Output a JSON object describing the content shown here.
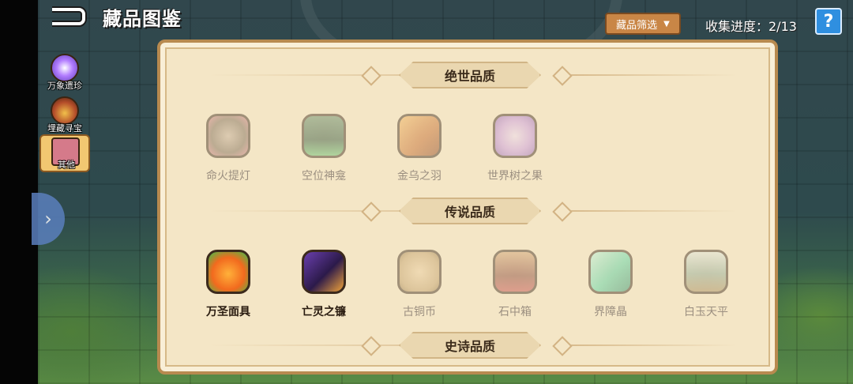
{
  "header": {
    "title": "藏品图鉴",
    "filter_label": "藏品筛选",
    "progress": "收集进度：2/13",
    "help_label": "?"
  },
  "sidebar": {
    "items": [
      {
        "label": "万象遗珍",
        "active": false
      },
      {
        "label": "埋藏寻宝",
        "active": false
      },
      {
        "label": "其他",
        "active": true
      }
    ]
  },
  "sections": [
    {
      "title": "绝世品质",
      "items": [
        {
          "name": "命火提灯",
          "owned": false,
          "icon": "lantern-icon"
        },
        {
          "name": "空位神龛",
          "owned": false,
          "icon": "shrine-icon"
        },
        {
          "name": "金乌之羽",
          "owned": false,
          "icon": "feather-icon"
        },
        {
          "name": "世界树之果",
          "owned": false,
          "icon": "fruit-icon"
        }
      ]
    },
    {
      "title": "传说品质",
      "items": [
        {
          "name": "万圣面具",
          "owned": true,
          "icon": "pumpkin-mask-icon"
        },
        {
          "name": "亡灵之镰",
          "owned": true,
          "icon": "scythe-icon"
        },
        {
          "name": "古铜币",
          "owned": false,
          "icon": "coin-icon"
        },
        {
          "name": "石中箱",
          "owned": false,
          "icon": "chest-icon"
        },
        {
          "name": "界障晶",
          "owned": false,
          "icon": "crystal-icon"
        },
        {
          "name": "白玉天平",
          "owned": false,
          "icon": "scale-icon"
        }
      ]
    },
    {
      "title": "史诗品质",
      "items": []
    }
  ],
  "colors": {
    "panel_bg": "#f4e6c6",
    "filter_bg": "#c98646",
    "help_bg": "#2f8fe0"
  }
}
